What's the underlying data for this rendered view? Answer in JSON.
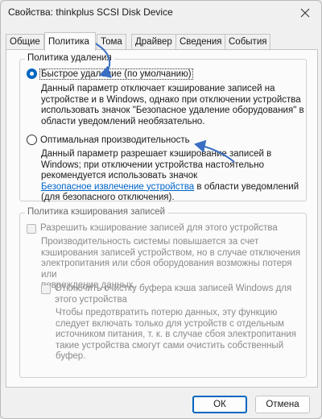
{
  "window": {
    "title": "Свойства:  thinkplus SCSI Disk Device",
    "close_icon": "close-icon"
  },
  "tabs": [
    {
      "label": "Общие",
      "active": false
    },
    {
      "label": "Политика",
      "active": true
    },
    {
      "label": "Тома",
      "active": false
    },
    {
      "label": "Драйвер",
      "active": false
    },
    {
      "label": "Сведения",
      "active": false
    },
    {
      "label": "События",
      "active": false
    }
  ],
  "removal_policy": {
    "legend": "Политика удаления",
    "quick": {
      "label": "Быстрое удаление (по умолчанию)",
      "checked": true,
      "desc": [
        "Данный параметр отключает кэширование записей на",
        "устройстве и в Windows, однако при отключении устройства",
        "использовать значок \"Безопасное удаление оборудования\" в",
        "области уведомлений необязательно."
      ]
    },
    "performance": {
      "label": "Оптимальная производительность",
      "checked": false,
      "desc": [
        "Данный параметр разрешает кэширование записей в",
        "Windows; при отключении устройства настоятельно",
        "рекомендуется использовать значок"
      ],
      "link": "Безопасное извлечение устройства",
      "desc_after_link": " в области уведомлений",
      "desc_last": "(для безопасного отключения)."
    }
  },
  "write_cache": {
    "legend": "Политика кэширования записей",
    "enable": {
      "label": "Разрешить кэширование записей для этого устройства",
      "checked": false,
      "desc": [
        "Производительность системы повышается за счет",
        "кэширования записей устройством, но в случае отключения",
        "электропитания или сбоя оборудования возможны потеря или",
        "повреждение данных."
      ]
    },
    "flush": {
      "label": [
        "Отключить очистку буфера кэша записей Windows для",
        "этого устройства"
      ],
      "checked": false,
      "desc": [
        "Чтобы предотвратить потерю данных, эту функцию",
        "следует включать только для устройств с отдельным",
        "источником питания, т. к.  в случае сбоя электропитания",
        "такие устройства смогут сами очистить собственный",
        "буфер."
      ]
    }
  },
  "buttons": {
    "ok": "ОК",
    "cancel": "Отмена"
  },
  "colors": {
    "accent": "#0067c0",
    "link": "#0066cc",
    "annotation_arrow": "#3a6fc4"
  }
}
